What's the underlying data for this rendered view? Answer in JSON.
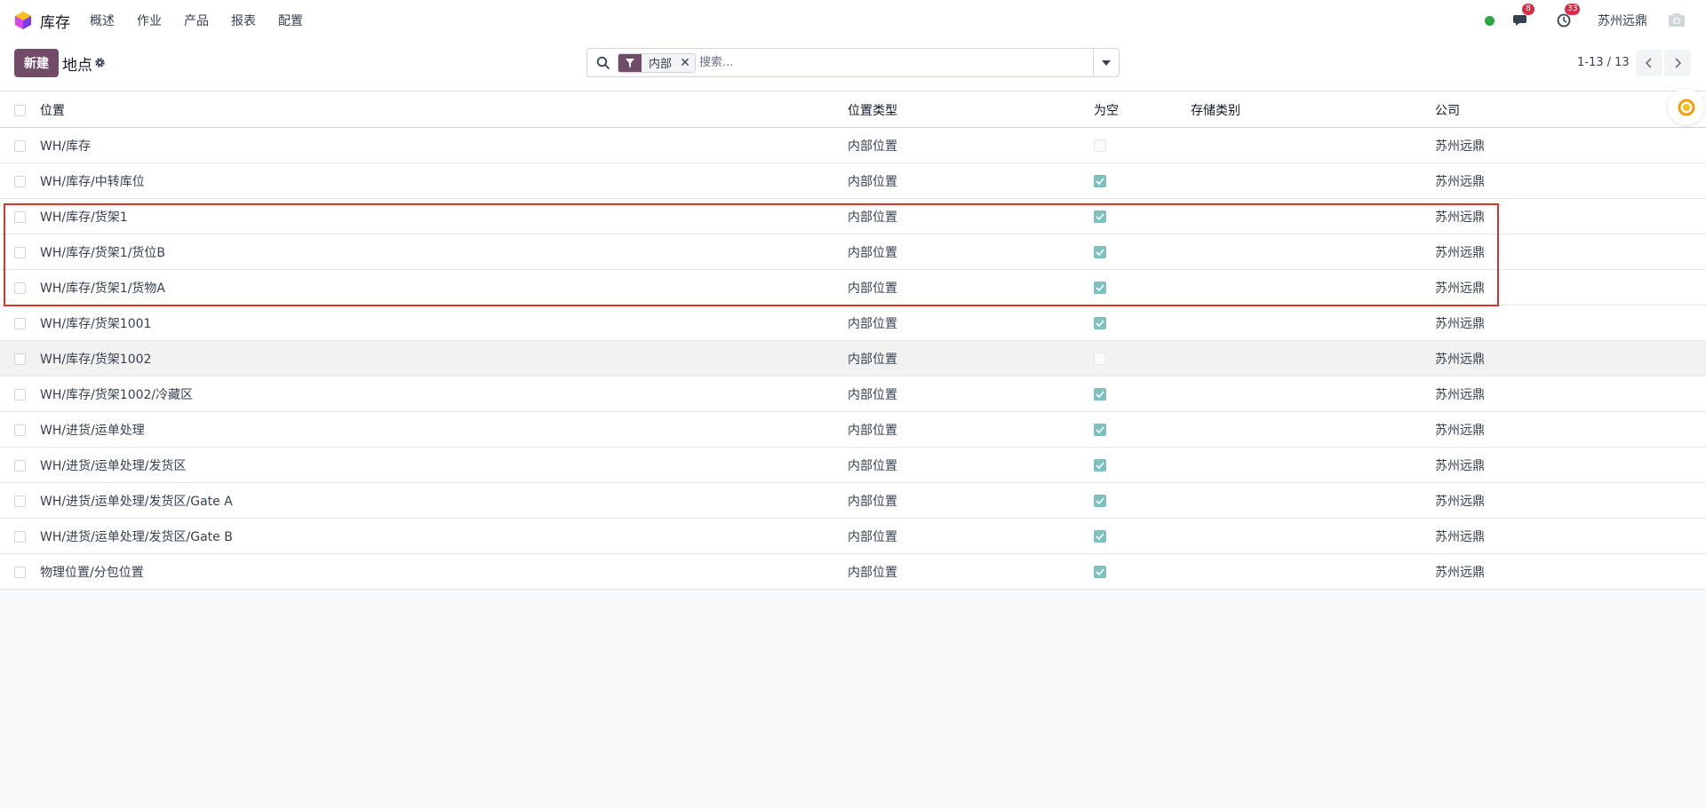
{
  "navbar": {
    "app_name": "库存",
    "menu": [
      "概述",
      "作业",
      "产品",
      "报表",
      "配置"
    ],
    "messages_badge": "8",
    "activities_badge": "33",
    "company": "苏州远鼎",
    "status_color": "#28a745"
  },
  "control_panel": {
    "new_button": "新建",
    "title": "地点",
    "search": {
      "facet_label": "内部",
      "placeholder": "搜索..."
    },
    "pager": "1-13 / 13"
  },
  "list": {
    "columns": {
      "name": "位置",
      "type": "位置类型",
      "empty": "为空",
      "storage_category": "存储类别",
      "company": "公司"
    },
    "rows": [
      {
        "name": "WH/库存",
        "type": "内部位置",
        "is_empty": false,
        "storage_category": "",
        "company": "苏州远鼎"
      },
      {
        "name": "WH/库存/中转库位",
        "type": "内部位置",
        "is_empty": true,
        "storage_category": "",
        "company": "苏州远鼎"
      },
      {
        "name": "WH/库存/货架1",
        "type": "内部位置",
        "is_empty": true,
        "storage_category": "",
        "company": "苏州远鼎"
      },
      {
        "name": "WH/库存/货架1/货位B",
        "type": "内部位置",
        "is_empty": true,
        "storage_category": "",
        "company": "苏州远鼎"
      },
      {
        "name": "WH/库存/货架1/货物A",
        "type": "内部位置",
        "is_empty": true,
        "storage_category": "",
        "company": "苏州远鼎"
      },
      {
        "name": "WH/库存/货架1001",
        "type": "内部位置",
        "is_empty": true,
        "storage_category": "",
        "company": "苏州远鼎"
      },
      {
        "name": "WH/库存/货架1002",
        "type": "内部位置",
        "is_empty": false,
        "storage_category": "",
        "company": "苏州远鼎"
      },
      {
        "name": "WH/库存/货架1002/冷藏区",
        "type": "内部位置",
        "is_empty": true,
        "storage_category": "",
        "company": "苏州远鼎"
      },
      {
        "name": "WH/进货/运单处理",
        "type": "内部位置",
        "is_empty": true,
        "storage_category": "",
        "company": "苏州远鼎"
      },
      {
        "name": "WH/进货/运单处理/发货区",
        "type": "内部位置",
        "is_empty": true,
        "storage_category": "",
        "company": "苏州远鼎"
      },
      {
        "name": "WH/进货/运单处理/发货区/Gate A",
        "type": "内部位置",
        "is_empty": true,
        "storage_category": "",
        "company": "苏州远鼎"
      },
      {
        "name": "WH/进货/运单处理/发货区/Gate B",
        "type": "内部位置",
        "is_empty": true,
        "storage_category": "",
        "company": "苏州远鼎"
      },
      {
        "name": "物理位置/分包位置",
        "type": "内部位置",
        "is_empty": true,
        "storage_category": "",
        "company": "苏州远鼎"
      }
    ],
    "highlighted_row": 6
  }
}
